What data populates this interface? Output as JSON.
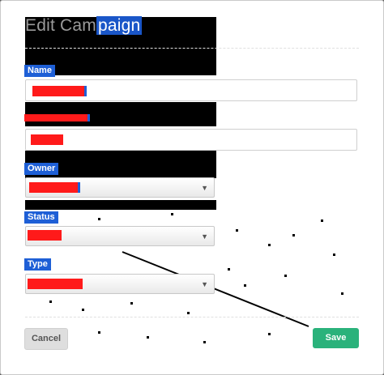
{
  "modal": {
    "title_prefix": "Edit Cam",
    "title_selected": "paign",
    "fields": {
      "name_label": "Name",
      "owner_label": "Owner",
      "status_label": "Status",
      "type_label": "Type"
    },
    "buttons": {
      "cancel": "Cancel",
      "save": "Save"
    },
    "colors": {
      "save": "#2ab27b",
      "label_highlight": "#1e5fd6",
      "redaction": "#ff1a1a"
    }
  }
}
